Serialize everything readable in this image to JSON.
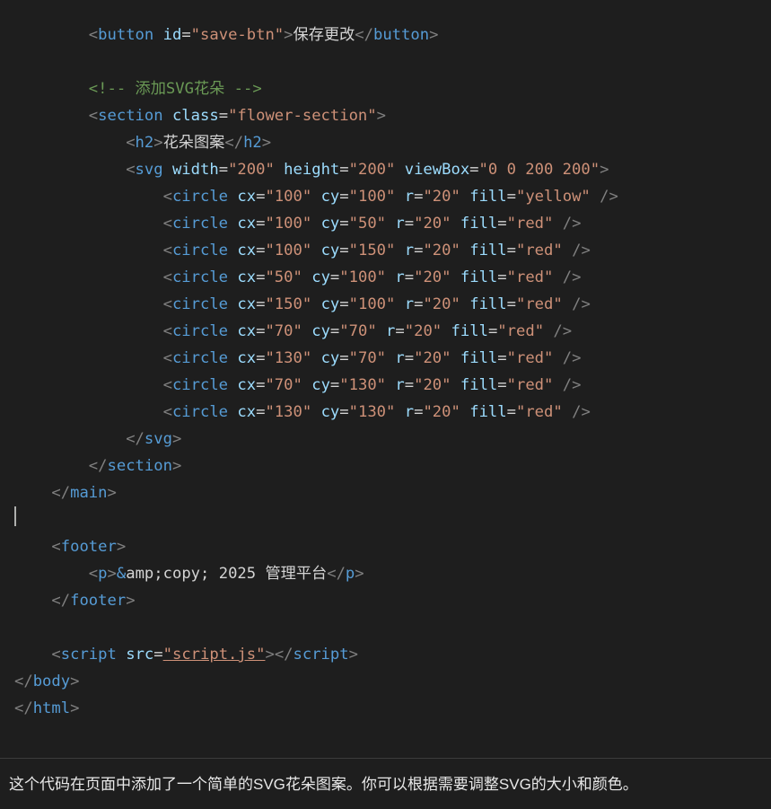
{
  "message": "这个代码在页面中添加了一个简单的SVG花朵图案。你可以根据需要调整SVG的大小和颜色。",
  "code": {
    "lines": [
      {
        "indent": 8,
        "kind": "open_tag",
        "tag": "button",
        "attrs": [
          [
            "id",
            "\"save-btn\""
          ]
        ],
        "text": "保存更改",
        "close": "button"
      },
      {
        "indent": 0,
        "kind": "blank"
      },
      {
        "indent": 8,
        "kind": "comment",
        "text": " 添加SVG花朵 "
      },
      {
        "indent": 8,
        "kind": "open_tag",
        "tag": "section",
        "attrs": [
          [
            "class",
            "\"flower-section\""
          ]
        ]
      },
      {
        "indent": 12,
        "kind": "open_tag",
        "tag": "h2",
        "text": "花朵图案",
        "close": "h2"
      },
      {
        "indent": 12,
        "kind": "open_tag",
        "tag": "svg",
        "attrs": [
          [
            "width",
            "\"200\""
          ],
          [
            "height",
            "\"200\""
          ],
          [
            "viewBox",
            "\"0 0 200 200\""
          ]
        ]
      },
      {
        "indent": 16,
        "kind": "self_tag",
        "tag": "circle",
        "attrs": [
          [
            "cx",
            "\"100\""
          ],
          [
            "cy",
            "\"100\""
          ],
          [
            "r",
            "\"20\""
          ],
          [
            "fill",
            "\"yellow\""
          ]
        ]
      },
      {
        "indent": 16,
        "kind": "self_tag",
        "tag": "circle",
        "attrs": [
          [
            "cx",
            "\"100\""
          ],
          [
            "cy",
            "\"50\""
          ],
          [
            "r",
            "\"20\""
          ],
          [
            "fill",
            "\"red\""
          ]
        ]
      },
      {
        "indent": 16,
        "kind": "self_tag",
        "tag": "circle",
        "attrs": [
          [
            "cx",
            "\"100\""
          ],
          [
            "cy",
            "\"150\""
          ],
          [
            "r",
            "\"20\""
          ],
          [
            "fill",
            "\"red\""
          ]
        ]
      },
      {
        "indent": 16,
        "kind": "self_tag",
        "tag": "circle",
        "attrs": [
          [
            "cx",
            "\"50\""
          ],
          [
            "cy",
            "\"100\""
          ],
          [
            "r",
            "\"20\""
          ],
          [
            "fill",
            "\"red\""
          ]
        ]
      },
      {
        "indent": 16,
        "kind": "self_tag",
        "tag": "circle",
        "attrs": [
          [
            "cx",
            "\"150\""
          ],
          [
            "cy",
            "\"100\""
          ],
          [
            "r",
            "\"20\""
          ],
          [
            "fill",
            "\"red\""
          ]
        ]
      },
      {
        "indent": 16,
        "kind": "self_tag",
        "tag": "circle",
        "attrs": [
          [
            "cx",
            "\"70\""
          ],
          [
            "cy",
            "\"70\""
          ],
          [
            "r",
            "\"20\""
          ],
          [
            "fill",
            "\"red\""
          ]
        ]
      },
      {
        "indent": 16,
        "kind": "self_tag",
        "tag": "circle",
        "attrs": [
          [
            "cx",
            "\"130\""
          ],
          [
            "cy",
            "\"70\""
          ],
          [
            "r",
            "\"20\""
          ],
          [
            "fill",
            "\"red\""
          ]
        ]
      },
      {
        "indent": 16,
        "kind": "self_tag",
        "tag": "circle",
        "attrs": [
          [
            "cx",
            "\"70\""
          ],
          [
            "cy",
            "\"130\""
          ],
          [
            "r",
            "\"20\""
          ],
          [
            "fill",
            "\"red\""
          ]
        ]
      },
      {
        "indent": 16,
        "kind": "self_tag",
        "tag": "circle",
        "attrs": [
          [
            "cx",
            "\"130\""
          ],
          [
            "cy",
            "\"130\""
          ],
          [
            "r",
            "\"20\""
          ],
          [
            "fill",
            "\"red\""
          ]
        ]
      },
      {
        "indent": 12,
        "kind": "close_tag",
        "tag": "svg"
      },
      {
        "indent": 8,
        "kind": "close_tag",
        "tag": "section"
      },
      {
        "indent": 4,
        "kind": "close_tag",
        "tag": "main"
      },
      {
        "indent": 0,
        "kind": "blank"
      },
      {
        "indent": 4,
        "kind": "open_tag",
        "tag": "footer"
      },
      {
        "indent": 8,
        "kind": "open_tag",
        "tag": "p",
        "entity": "amp",
        "entity_tail": ";copy; 2025 管理平台",
        "close": "p"
      },
      {
        "indent": 4,
        "kind": "close_tag",
        "tag": "footer"
      },
      {
        "indent": 0,
        "kind": "blank"
      },
      {
        "indent": 4,
        "kind": "open_tag",
        "tag": "script",
        "attrs": [
          [
            "src",
            "\"script.js\""
          ]
        ],
        "close": "script",
        "underlineAttr": true
      },
      {
        "indent": 0,
        "kind": "close_tag",
        "tag": "body"
      },
      {
        "indent": 0,
        "kind": "close_tag",
        "tag": "html"
      }
    ]
  }
}
